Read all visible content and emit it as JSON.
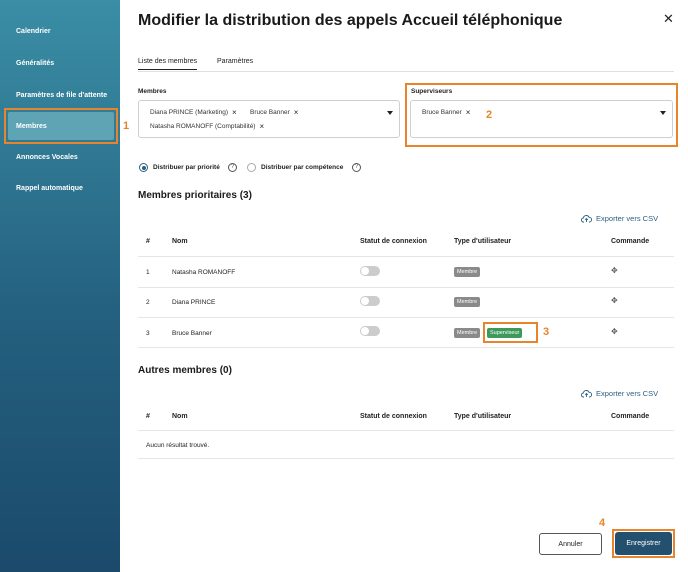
{
  "sidebar": {
    "items": [
      {
        "label": "Calendrier"
      },
      {
        "label": "Généralités"
      },
      {
        "label": "Paramètres de file d'attente"
      },
      {
        "label": "Membres"
      },
      {
        "label": "Annonces Vocales"
      },
      {
        "label": "Rappel automatique"
      }
    ],
    "active_index": 3
  },
  "dialog": {
    "title": "Modifier la distribution des appels Accueil téléphonique",
    "close_glyph": "✕"
  },
  "tabs": [
    {
      "label": "Liste des membres",
      "active": true
    },
    {
      "label": "Paramètres",
      "active": false
    }
  ],
  "members_field": {
    "label": "Membres",
    "chips": [
      "Diana PRINCE (Marketing)",
      "Bruce Banner",
      "Natasha ROMANOFF (Comptabilité)"
    ]
  },
  "supervisors_field": {
    "label": "Superviseurs",
    "chips": [
      "Bruce Banner"
    ]
  },
  "distribution": {
    "options": [
      {
        "label": "Distribuer par priorité",
        "selected": true
      },
      {
        "label": "Distribuer par compétence",
        "selected": false
      }
    ],
    "help_glyph": "?"
  },
  "priority_members": {
    "title": "Membres prioritaires (3)",
    "export_label": "Exporter vers CSV",
    "columns": [
      "#",
      "Nom",
      "Statut de connexion",
      "Type d'utilisateur",
      "Commande"
    ],
    "rows": [
      {
        "num": "1",
        "name": "Natasha ROMANOFF",
        "connected": false,
        "types": [
          "Membre"
        ]
      },
      {
        "num": "2",
        "name": "Diana PRINCE",
        "connected": false,
        "types": [
          "Membre"
        ]
      },
      {
        "num": "3",
        "name": "Bruce Banner",
        "connected": false,
        "types": [
          "Membre",
          "Superviseur"
        ]
      }
    ]
  },
  "other_members": {
    "title": "Autres membres (0)",
    "export_label": "Exporter vers CSV",
    "columns": [
      "#",
      "Nom",
      "Statut de connexion",
      "Type d'utilisateur",
      "Commande"
    ],
    "empty_text": "Aucun résultat trouvé."
  },
  "buttons": {
    "cancel": "Annuler",
    "save": "Enregistrer"
  },
  "callouts": [
    "1",
    "2",
    "3",
    "4"
  ],
  "colors": {
    "accent": "#24506f",
    "highlight": "#e8842c",
    "supervisor_badge": "#3e9a5a",
    "member_badge": "#8a8a8a"
  },
  "icons": {
    "move": "drag-move-icon",
    "export": "cloud-upload-icon"
  }
}
